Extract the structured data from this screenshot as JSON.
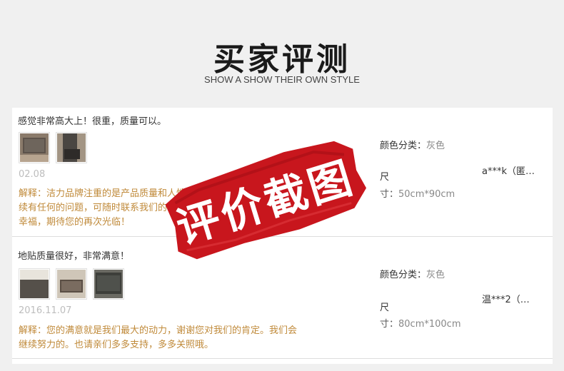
{
  "header": {
    "title": "买家评测",
    "subtitle": "SHOW A SHOW THEIR OWN STYLE"
  },
  "reviews": [
    {
      "content": "感觉非常高大上！很重，质量可以。",
      "date": "02.08",
      "reply": "解释：洁力品牌注重的是产品质量和人性化...续有任何的问题，可随时联系我们的...幸福，期待您的再次光临！",
      "reply_lines": [
        "解释：洁力品牌注重的是产品质量和人性",
        "续有任何的问题，可随时联系我们的",
        "幸福，期待您的再次光临！"
      ],
      "color_label": "颜色分类：",
      "color_value": "灰色",
      "size_label": "尺",
      "size_prefix": "寸：",
      "size_value": "50cm*90cm",
      "user": "a***k（匿…"
    },
    {
      "content": "地贴质量很好，非常满意！",
      "date": "2016.11.07",
      "reply_lines": [
        "解释：您的满意就是我们最大的动力，谢谢您对我们的肯定。我们会",
        "继续努力的。也请亲们多多支持，多多关照哦。"
      ],
      "color_label": "颜色分类：",
      "color_value": "灰色",
      "size_label": "尺",
      "size_prefix": "寸：",
      "size_value": "80cm*100cm",
      "user": "温***2（…"
    }
  ],
  "stamp": {
    "text": "评价截图",
    "color": "#c8161d"
  }
}
